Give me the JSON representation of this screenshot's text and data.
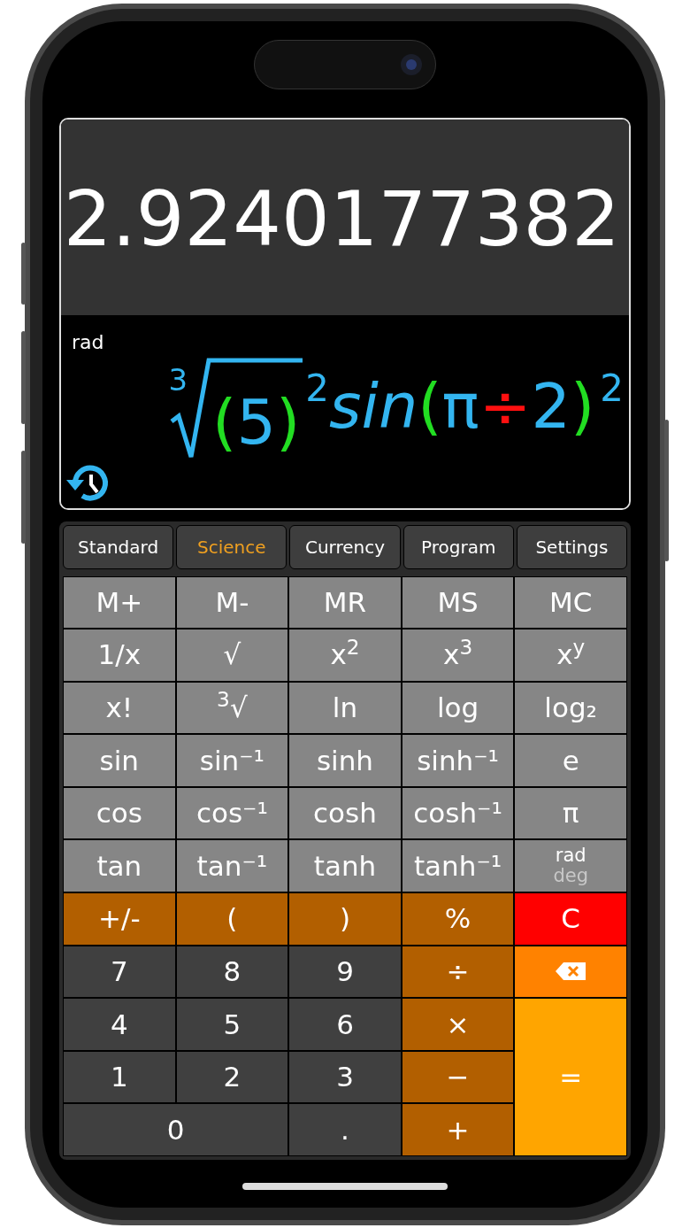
{
  "display": {
    "result": "2.9240177382",
    "angle_mode": "rad",
    "expression": [
      {
        "kind": "root",
        "index": "3",
        "children": [
          {
            "kind": "paren",
            "text": "("
          },
          {
            "kind": "num",
            "text": "5"
          },
          {
            "kind": "paren",
            "text": ")"
          }
        ]
      },
      {
        "kind": "sup",
        "text": "2"
      },
      {
        "kind": "func",
        "text": "sin"
      },
      {
        "kind": "paren",
        "text": "("
      },
      {
        "kind": "num",
        "text": "π"
      },
      {
        "kind": "op",
        "text": "÷"
      },
      {
        "kind": "num",
        "text": "2"
      },
      {
        "kind": "paren",
        "text": ")"
      },
      {
        "kind": "sup",
        "text": "2"
      }
    ]
  },
  "tabs": [
    {
      "label": "Standard",
      "selected": false
    },
    {
      "label": "Science",
      "selected": true
    },
    {
      "label": "Currency",
      "selected": false
    },
    {
      "label": "Program",
      "selected": false
    },
    {
      "label": "Settings",
      "selected": false
    }
  ],
  "keys": [
    {
      "kind": "function",
      "label": "M+"
    },
    {
      "kind": "function",
      "label": "M-"
    },
    {
      "kind": "function",
      "label": "MR"
    },
    {
      "kind": "function",
      "label": "MS"
    },
    {
      "kind": "function",
      "label": "MC"
    },
    {
      "kind": "function",
      "label": "1/x"
    },
    {
      "kind": "function",
      "label": "√"
    },
    {
      "kind": "function",
      "label": "x$^{2}$"
    },
    {
      "kind": "function",
      "label": "x$^{3}$"
    },
    {
      "kind": "function",
      "label": "x$^{y}$"
    },
    {
      "kind": "function",
      "label": "x!"
    },
    {
      "kind": "function",
      "label": "$^{3}$√"
    },
    {
      "kind": "function",
      "label": "ln"
    },
    {
      "kind": "function",
      "label": "log"
    },
    {
      "kind": "function",
      "label": "log₂"
    },
    {
      "kind": "function",
      "label": "sin"
    },
    {
      "kind": "function",
      "label": "sin⁻¹"
    },
    {
      "kind": "function",
      "label": "sinh"
    },
    {
      "kind": "function",
      "label": "sinh⁻¹"
    },
    {
      "kind": "function",
      "label": "e"
    },
    {
      "kind": "function",
      "label": "cos"
    },
    {
      "kind": "function",
      "label": "cos⁻¹"
    },
    {
      "kind": "function",
      "label": "cosh"
    },
    {
      "kind": "function",
      "label": "cosh⁻¹"
    },
    {
      "kind": "function",
      "label": "π"
    },
    {
      "kind": "function",
      "label": "tan"
    },
    {
      "kind": "function",
      "label": "tan⁻¹"
    },
    {
      "kind": "function",
      "label": "tanh"
    },
    {
      "kind": "function",
      "label": "tanh⁻¹"
    },
    {
      "kind": "angle",
      "options": [
        {
          "label": "rad",
          "selected": true
        },
        {
          "label": "deg",
          "selected": false
        }
      ]
    },
    {
      "kind": "operator",
      "label": "+/-"
    },
    {
      "kind": "operator",
      "label": "("
    },
    {
      "kind": "operator",
      "label": ")"
    },
    {
      "kind": "operator",
      "label": "%"
    },
    {
      "kind": "clear",
      "label": "C"
    },
    {
      "kind": "digit",
      "label": "7"
    },
    {
      "kind": "digit",
      "label": "8"
    },
    {
      "kind": "digit",
      "label": "9"
    },
    {
      "kind": "operator",
      "label": "÷"
    },
    {
      "kind": "backspace"
    },
    {
      "kind": "digit",
      "label": "4"
    },
    {
      "kind": "digit",
      "label": "5"
    },
    {
      "kind": "digit",
      "label": "6"
    },
    {
      "kind": "operator",
      "label": "×"
    },
    {
      "kind": "digit",
      "label": "1"
    },
    {
      "kind": "digit",
      "label": "2"
    },
    {
      "kind": "digit",
      "label": "3"
    },
    {
      "kind": "operator",
      "label": "−"
    },
    {
      "kind": "zero",
      "label": "0"
    },
    {
      "kind": "digit",
      "label": "."
    },
    {
      "kind": "operator",
      "label": "+"
    },
    {
      "kind": "equals",
      "label": "="
    }
  ]
}
